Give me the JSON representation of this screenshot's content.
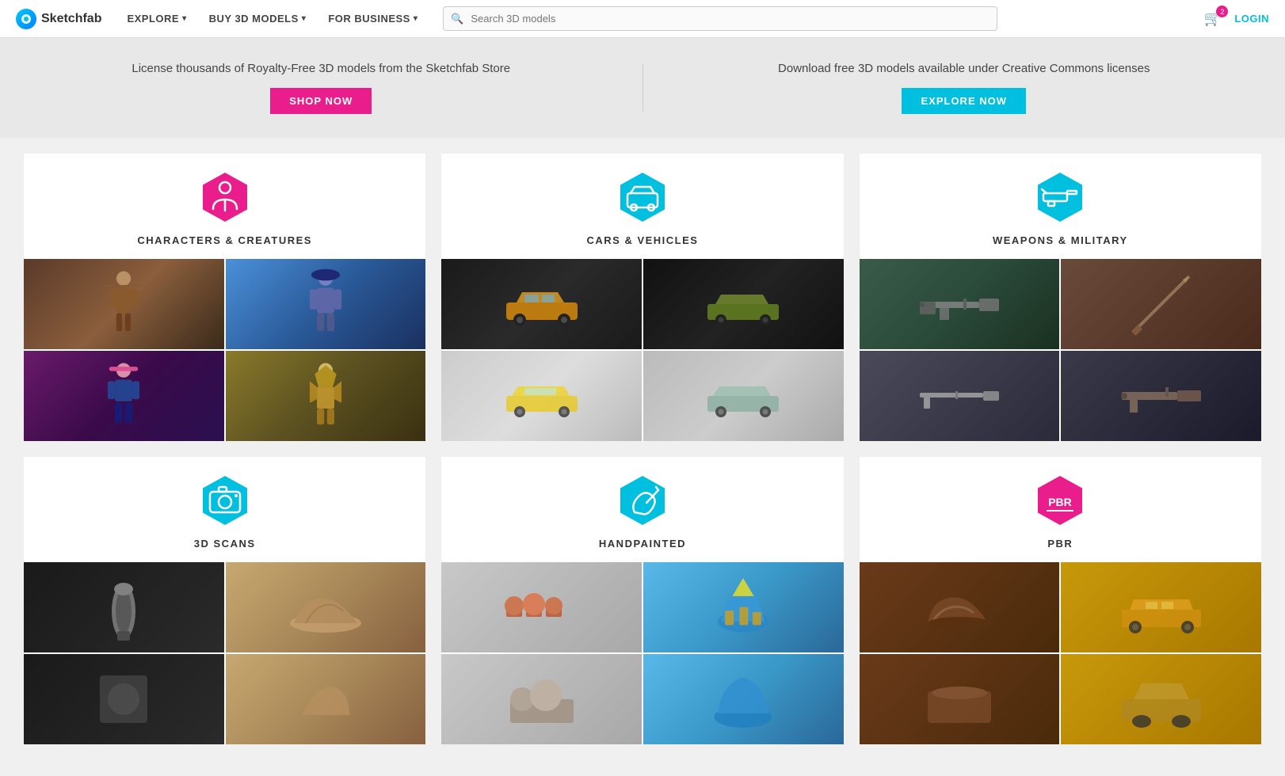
{
  "navbar": {
    "logo_text": "Sketchfab",
    "nav_items": [
      {
        "label": "EXPLORE",
        "has_dropdown": true
      },
      {
        "label": "BUY 3D MODELS",
        "has_dropdown": true
      },
      {
        "label": "FOR BUSINESS",
        "has_dropdown": true
      }
    ],
    "search_placeholder": "Search 3D models",
    "cart_badge": "2",
    "login_label": "LOGIN"
  },
  "promo": {
    "left_text": "License thousands of Royalty-Free 3D models from the Sketchfab Store",
    "left_btn": "SHOP NOW",
    "right_text": "Download free 3D models available under Creative Commons licenses",
    "right_btn": "EXPLORE NOW"
  },
  "categories": [
    {
      "id": "characters",
      "title": "CHARACTERS & CREATURES",
      "icon_color": "#e91e8c",
      "icon_type": "character",
      "images": [
        {
          "color": "#5a3a2a",
          "color2": "#3a2010"
        },
        {
          "color": "#4a90d9",
          "color2": "#1a3060"
        },
        {
          "color": "#6a1a6a",
          "color2": "#2a1050"
        },
        {
          "color": "#8a7a2a",
          "color2": "#3a3010"
        }
      ]
    },
    {
      "id": "cars",
      "title": "CARS & VEHICLES",
      "icon_color": "#00bfdf",
      "icon_type": "car",
      "images": [
        {
          "color": "#111111",
          "color2": "#1a1a1a"
        },
        {
          "color": "#111111",
          "color2": "#222222"
        },
        {
          "color": "#cccccc",
          "color2": "#dddddd"
        },
        {
          "color": "#bbbbbb",
          "color2": "#aaaaaa"
        }
      ]
    },
    {
      "id": "weapons",
      "title": "WEAPONS & MILITARY",
      "icon_color": "#00bfdf",
      "icon_type": "weapon",
      "images": [
        {
          "color": "#3a5a4a",
          "color2": "#1a3020"
        },
        {
          "color": "#6a4a3a",
          "color2": "#4a2010"
        },
        {
          "color": "#4a4a5a",
          "color2": "#2a2a3a"
        },
        {
          "color": "#3a3a4a",
          "color2": "#1a1a2a"
        }
      ]
    },
    {
      "id": "scans",
      "title": "3D SCANS",
      "icon_color": "#00bfdf",
      "icon_type": "camera",
      "images": [
        {
          "color": "#1a1a1a",
          "color2": "#2a2a2a"
        },
        {
          "color": "#c8a870",
          "color2": "#876040"
        },
        {
          "color": "#1a1a1a",
          "color2": "#2a2a2a"
        },
        {
          "color": "#c8a870",
          "color2": "#876040"
        }
      ]
    },
    {
      "id": "handpainted",
      "title": "HANDPAINTED",
      "icon_color": "#00bfdf",
      "icon_type": "brush",
      "images": [
        {
          "color": "#c8c8c8",
          "color2": "#a8a8a8"
        },
        {
          "color": "#5ab8e8",
          "color2": "#2a6898"
        },
        {
          "color": "#c8c8c8",
          "color2": "#a8a8a8"
        },
        {
          "color": "#5ab8e8",
          "color2": "#2a6898"
        }
      ]
    },
    {
      "id": "pbr",
      "title": "PBR",
      "icon_color": "#e91e8c",
      "icon_type": "pbr",
      "images": [
        {
          "color": "#6a3a1a",
          "color2": "#4a2010"
        },
        {
          "color": "#c89810",
          "color2": "#a87800"
        },
        {
          "color": "#6a3a1a",
          "color2": "#4a2010"
        },
        {
          "color": "#c89810",
          "color2": "#a87800"
        }
      ]
    }
  ]
}
